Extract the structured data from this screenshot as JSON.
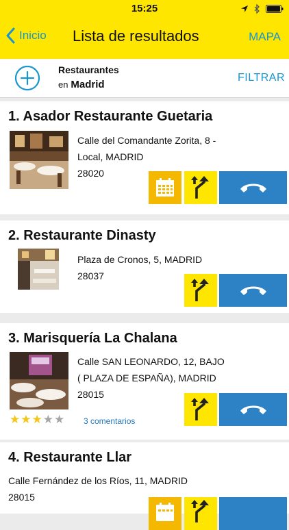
{
  "status": {
    "time": "15:25"
  },
  "nav": {
    "back_label": "Inicio",
    "title": "Lista de resultados",
    "map_label": "MAPA"
  },
  "search": {
    "category": "Restaurantes",
    "location_prefix": "en",
    "location": "Madrid",
    "filter_label": "FILTRAR"
  },
  "results": [
    {
      "title": "1. Asador Restaurante Guetaria",
      "address_line1": "Calle del Comandante Zorita, 8 -",
      "address_line2": "Local, MADRID",
      "postal_code": "28020"
    },
    {
      "title": "2. Restaurante Dinasty",
      "address_line1": "Plaza de Cronos, 5, MADRID",
      "postal_code": "28037"
    },
    {
      "title": "3. Marisquería La Chalana",
      "address_line1": "Calle SAN LEONARDO, 12, BAJO",
      "address_line2": "( PLAZA DE ESPAÑA), MADRID",
      "postal_code": "28015",
      "rating": 3,
      "rating_max": 5,
      "comments_label": "3 comentarios"
    },
    {
      "title": "4. Restaurante Llar",
      "address_line1": "Calle Fernández de los Ríos, 11, MADRID",
      "postal_code": "28015"
    }
  ],
  "icons": {
    "back": "chevron-left-icon",
    "location": "location-arrow-icon",
    "bluetooth": "bluetooth-icon",
    "battery": "battery-icon",
    "add": "plus-circle-icon",
    "calendar": "calendar-icon",
    "directions": "directions-icon",
    "call": "phone-icon"
  },
  "colors": {
    "nav_bg": "#ffe600",
    "accent": "#1795cf",
    "calendar_btn": "#f5b800",
    "directions_btn": "#ffe600",
    "call_btn": "#2d82c6",
    "star": "#f5c518"
  }
}
